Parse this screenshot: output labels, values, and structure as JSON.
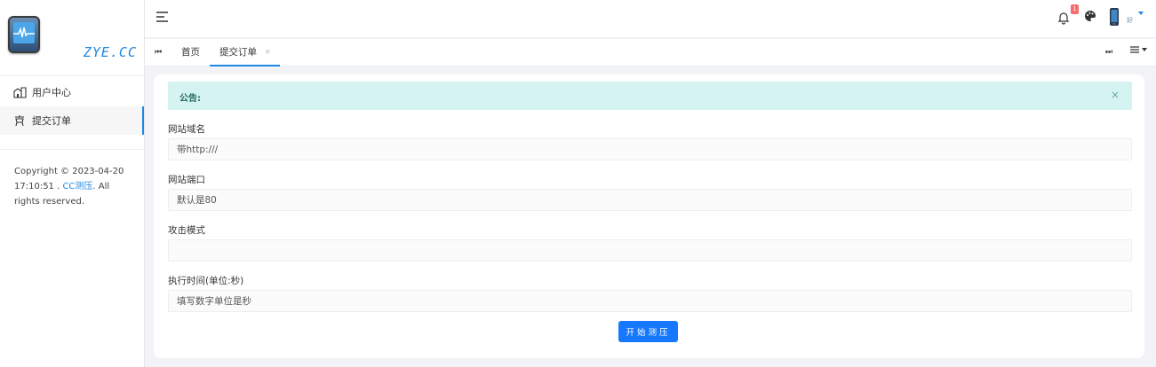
{
  "sidebar": {
    "logo_text": "ZYE.CC",
    "items": [
      {
        "label": "用户中心",
        "icon": "home-icon",
        "active": false
      },
      {
        "label": "提交订单",
        "icon": "order-icon",
        "active": true
      }
    ],
    "copyright_prefix": "Copyright © 2023-04-20 17:10:51 . ",
    "copyright_link": "CC测压",
    "copyright_suffix": ". All rights reserved."
  },
  "header": {
    "notification_count": "1",
    "user_name": "好"
  },
  "tabs": [
    {
      "label": "首页",
      "active": false
    },
    {
      "label": "提交订单",
      "active": true,
      "close": "×"
    }
  ],
  "notice": {
    "label": "公告:",
    "close": "×"
  },
  "form": {
    "domain": {
      "label": "网站域名",
      "placeholder": "带http:///",
      "value": ""
    },
    "port": {
      "label": "网站端口",
      "placeholder": "默认是80",
      "value": ""
    },
    "mode": {
      "label": "攻击模式",
      "placeholder": "",
      "value": ""
    },
    "duration": {
      "label": "执行时间(单位:秒)",
      "placeholder": "填写数字单位是秒",
      "value": ""
    },
    "submit_label": "开始测压"
  },
  "colors": {
    "accent": "#1677ff",
    "notice_bg": "#d5f4f1",
    "badge": "#f56c6c"
  }
}
